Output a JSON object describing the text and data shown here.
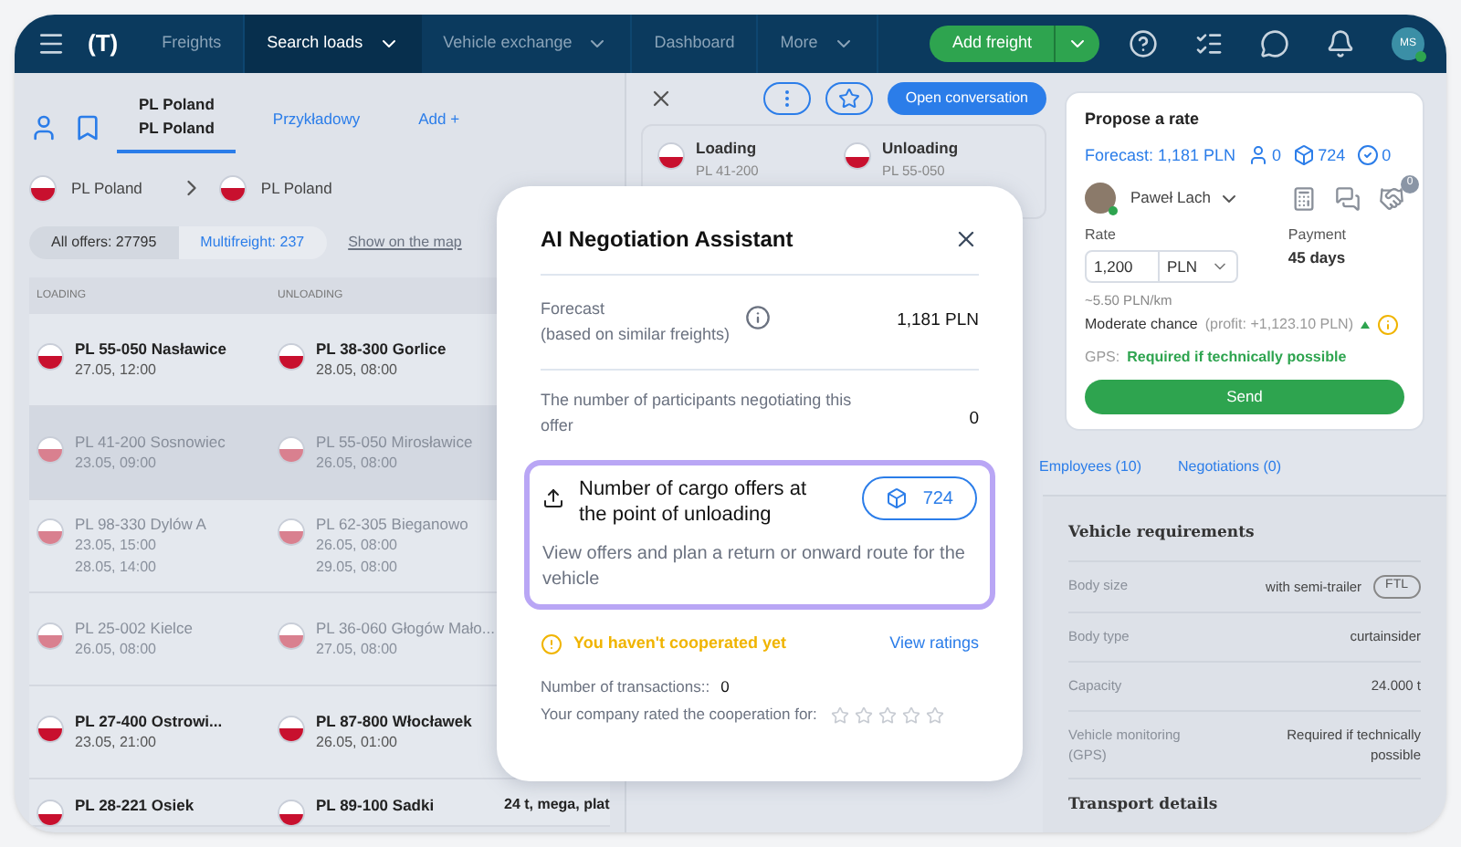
{
  "nav": {
    "logo": "(T)",
    "items": [
      {
        "label": "Freights",
        "selected": false,
        "dropdown": false
      },
      {
        "label": "Search loads",
        "selected": true,
        "dropdown": true
      },
      {
        "label": "Vehicle exchange",
        "selected": false,
        "dropdown": true
      },
      {
        "label": "Dashboard",
        "selected": false,
        "dropdown": false
      },
      {
        "label": "More",
        "selected": false,
        "dropdown": true
      }
    ],
    "add_button": "Add freight",
    "avatar": "MS"
  },
  "search_tabs": [
    {
      "lines": [
        "PL Poland",
        "PL Poland"
      ],
      "selected": true
    },
    {
      "lines": [
        "Przykładowy"
      ],
      "selected": false
    },
    {
      "lines": [
        "Add +"
      ],
      "selected": false
    }
  ],
  "route": {
    "from": "PL Poland",
    "to": "PL Poland"
  },
  "filters": [
    {
      "label": "All offers: 27795",
      "selected": true
    },
    {
      "label": "Multifreight: 237",
      "selected": false
    }
  ],
  "map_link": "Show on the map",
  "table": {
    "columns": [
      "LOADING",
      "UNLOADING"
    ],
    "rows": [
      {
        "loading": {
          "place": "PL 55-050 Nasławice",
          "dates": [
            "27.05, 12:00"
          ]
        },
        "unloading": {
          "place": "PL 38-300 Gorlice",
          "dates": [
            "28.05, 08:00"
          ]
        },
        "viewed": false,
        "selected": false
      },
      {
        "loading": {
          "place": "PL 41-200 Sosnowiec",
          "dates": [
            "23.05, 09:00"
          ]
        },
        "unloading": {
          "place": "PL 55-050 Mirosławice",
          "dates": [
            "26.05, 08:00"
          ]
        },
        "viewed": true,
        "selected": true
      },
      {
        "loading": {
          "place": "PL 98-330 Dylów A",
          "dates": [
            "23.05, 15:00",
            "28.05, 14:00"
          ]
        },
        "unloading": {
          "place": "PL 62-305 Bieganowo",
          "dates": [
            "26.05, 08:00",
            "29.05, 08:00"
          ]
        },
        "viewed": true,
        "selected": false
      },
      {
        "loading": {
          "place": "PL 25-002 Kielce",
          "dates": [
            "26.05, 08:00"
          ]
        },
        "unloading": {
          "place": "PL 36-060 Głogów Mało...",
          "dates": [
            "27.05, 08:00"
          ]
        },
        "viewed": true,
        "selected": false
      },
      {
        "loading": {
          "place": "PL 27-400 Ostrowi...",
          "dates": [
            "23.05, 21:00"
          ]
        },
        "unloading": {
          "place": "PL 87-800 Włocławek",
          "dates": [
            "26.05, 01:00"
          ]
        },
        "viewed": false,
        "selected": false
      },
      {
        "loading": {
          "place": "PL 28-221 Osiek"
        },
        "unloading": {
          "place": "PL 89-100 Sadki"
        },
        "cargo": "24 t, mega, plat",
        "viewed": false,
        "selected": false
      }
    ]
  },
  "detail": {
    "open_conversation": "Open conversation",
    "loading": {
      "label": "Loading",
      "place": "PL 41-200"
    },
    "unloading": {
      "label": "Unloading",
      "place": "PL 55-050"
    },
    "tabs": [
      {
        "label": "Employees (10)",
        "selected": false
      },
      {
        "label": "Negotiations (0)",
        "selected": false
      }
    ],
    "requirements_title": "Vehicle requirements",
    "requirements": [
      {
        "label": "Body size",
        "value": "with semi-trailer",
        "badge": "FTL"
      },
      {
        "label": "Body type",
        "value": "curtainsider"
      },
      {
        "label": "Capacity",
        "value": "24.000 t"
      },
      {
        "label": "Vehicle monitoring (GPS)",
        "value": "Required if technically possible"
      }
    ],
    "transport_title": "Transport details"
  },
  "propose": {
    "title": "Propose a rate",
    "forecast": "Forecast: 1,181 PLN",
    "participants": "0",
    "offers": "724",
    "accepted": "0",
    "person": "Paweł Lach",
    "notifications": "0",
    "rate_label": "Rate",
    "rate": "1,200",
    "currency": "PLN",
    "payment_label": "Payment",
    "payment": "45 days",
    "per_km": "~5.50 PLN/km",
    "chance": "Moderate chance",
    "profit": "(profit: +1,123.10 PLN)",
    "gps_label": "GPS:",
    "gps": "Required if technically possible",
    "send": "Send"
  },
  "modal": {
    "title": "AI Negotiation Assistant",
    "forecast_label": "Forecast",
    "forecast_note": "(based on similar freights)",
    "forecast_value": "1,181 PLN",
    "participants_label": "The number of participants negotiating this offer",
    "participants_value": "0",
    "offers_title": "Number of cargo offers at the point of unloading",
    "offers_count": "724",
    "offers_text": "View offers and plan a return or onward route for the vehicle",
    "warning": "You haven't cooperated yet",
    "ratings_link": "View ratings",
    "transactions_label": "Number of transactions::",
    "transactions_value": "0",
    "rated_label": "Your company rated the cooperation for:",
    "stars": 0
  }
}
